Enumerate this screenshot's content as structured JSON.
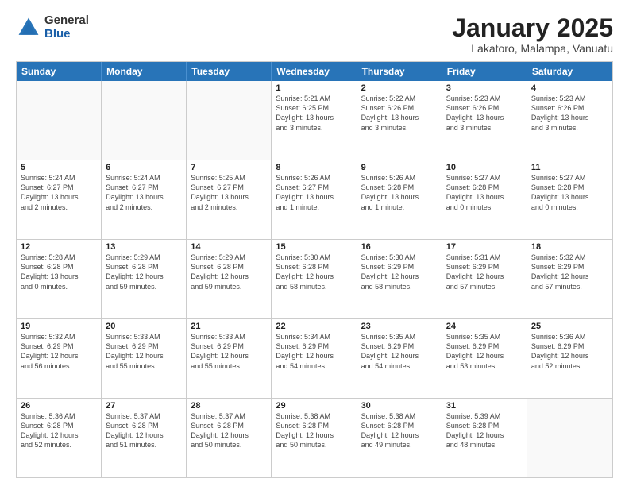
{
  "header": {
    "logo_general": "General",
    "logo_blue": "Blue",
    "title": "January 2025",
    "subtitle": "Lakatoro, Malampa, Vanuatu"
  },
  "day_headers": [
    "Sunday",
    "Monday",
    "Tuesday",
    "Wednesday",
    "Thursday",
    "Friday",
    "Saturday"
  ],
  "weeks": [
    [
      {
        "num": "",
        "info": ""
      },
      {
        "num": "",
        "info": ""
      },
      {
        "num": "",
        "info": ""
      },
      {
        "num": "1",
        "info": "Sunrise: 5:21 AM\nSunset: 6:25 PM\nDaylight: 13 hours\nand 3 minutes."
      },
      {
        "num": "2",
        "info": "Sunrise: 5:22 AM\nSunset: 6:26 PM\nDaylight: 13 hours\nand 3 minutes."
      },
      {
        "num": "3",
        "info": "Sunrise: 5:23 AM\nSunset: 6:26 PM\nDaylight: 13 hours\nand 3 minutes."
      },
      {
        "num": "4",
        "info": "Sunrise: 5:23 AM\nSunset: 6:26 PM\nDaylight: 13 hours\nand 3 minutes."
      }
    ],
    [
      {
        "num": "5",
        "info": "Sunrise: 5:24 AM\nSunset: 6:27 PM\nDaylight: 13 hours\nand 2 minutes."
      },
      {
        "num": "6",
        "info": "Sunrise: 5:24 AM\nSunset: 6:27 PM\nDaylight: 13 hours\nand 2 minutes."
      },
      {
        "num": "7",
        "info": "Sunrise: 5:25 AM\nSunset: 6:27 PM\nDaylight: 13 hours\nand 2 minutes."
      },
      {
        "num": "8",
        "info": "Sunrise: 5:26 AM\nSunset: 6:27 PM\nDaylight: 13 hours\nand 1 minute."
      },
      {
        "num": "9",
        "info": "Sunrise: 5:26 AM\nSunset: 6:28 PM\nDaylight: 13 hours\nand 1 minute."
      },
      {
        "num": "10",
        "info": "Sunrise: 5:27 AM\nSunset: 6:28 PM\nDaylight: 13 hours\nand 0 minutes."
      },
      {
        "num": "11",
        "info": "Sunrise: 5:27 AM\nSunset: 6:28 PM\nDaylight: 13 hours\nand 0 minutes."
      }
    ],
    [
      {
        "num": "12",
        "info": "Sunrise: 5:28 AM\nSunset: 6:28 PM\nDaylight: 13 hours\nand 0 minutes."
      },
      {
        "num": "13",
        "info": "Sunrise: 5:29 AM\nSunset: 6:28 PM\nDaylight: 12 hours\nand 59 minutes."
      },
      {
        "num": "14",
        "info": "Sunrise: 5:29 AM\nSunset: 6:28 PM\nDaylight: 12 hours\nand 59 minutes."
      },
      {
        "num": "15",
        "info": "Sunrise: 5:30 AM\nSunset: 6:28 PM\nDaylight: 12 hours\nand 58 minutes."
      },
      {
        "num": "16",
        "info": "Sunrise: 5:30 AM\nSunset: 6:29 PM\nDaylight: 12 hours\nand 58 minutes."
      },
      {
        "num": "17",
        "info": "Sunrise: 5:31 AM\nSunset: 6:29 PM\nDaylight: 12 hours\nand 57 minutes."
      },
      {
        "num": "18",
        "info": "Sunrise: 5:32 AM\nSunset: 6:29 PM\nDaylight: 12 hours\nand 57 minutes."
      }
    ],
    [
      {
        "num": "19",
        "info": "Sunrise: 5:32 AM\nSunset: 6:29 PM\nDaylight: 12 hours\nand 56 minutes."
      },
      {
        "num": "20",
        "info": "Sunrise: 5:33 AM\nSunset: 6:29 PM\nDaylight: 12 hours\nand 55 minutes."
      },
      {
        "num": "21",
        "info": "Sunrise: 5:33 AM\nSunset: 6:29 PM\nDaylight: 12 hours\nand 55 minutes."
      },
      {
        "num": "22",
        "info": "Sunrise: 5:34 AM\nSunset: 6:29 PM\nDaylight: 12 hours\nand 54 minutes."
      },
      {
        "num": "23",
        "info": "Sunrise: 5:35 AM\nSunset: 6:29 PM\nDaylight: 12 hours\nand 54 minutes."
      },
      {
        "num": "24",
        "info": "Sunrise: 5:35 AM\nSunset: 6:29 PM\nDaylight: 12 hours\nand 53 minutes."
      },
      {
        "num": "25",
        "info": "Sunrise: 5:36 AM\nSunset: 6:29 PM\nDaylight: 12 hours\nand 52 minutes."
      }
    ],
    [
      {
        "num": "26",
        "info": "Sunrise: 5:36 AM\nSunset: 6:28 PM\nDaylight: 12 hours\nand 52 minutes."
      },
      {
        "num": "27",
        "info": "Sunrise: 5:37 AM\nSunset: 6:28 PM\nDaylight: 12 hours\nand 51 minutes."
      },
      {
        "num": "28",
        "info": "Sunrise: 5:37 AM\nSunset: 6:28 PM\nDaylight: 12 hours\nand 50 minutes."
      },
      {
        "num": "29",
        "info": "Sunrise: 5:38 AM\nSunset: 6:28 PM\nDaylight: 12 hours\nand 50 minutes."
      },
      {
        "num": "30",
        "info": "Sunrise: 5:38 AM\nSunset: 6:28 PM\nDaylight: 12 hours\nand 49 minutes."
      },
      {
        "num": "31",
        "info": "Sunrise: 5:39 AM\nSunset: 6:28 PM\nDaylight: 12 hours\nand 48 minutes."
      },
      {
        "num": "",
        "info": ""
      }
    ]
  ]
}
